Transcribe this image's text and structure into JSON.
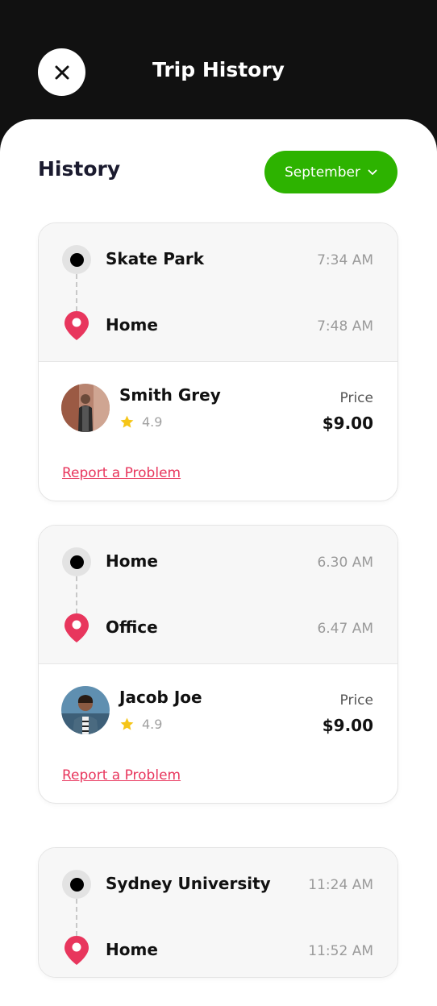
{
  "header": {
    "title": "Trip History",
    "close_icon": "close-icon"
  },
  "section": {
    "title": "History",
    "month_filter": "September"
  },
  "colors": {
    "accent_green": "#2db300",
    "pin_red": "#e8365d",
    "star_yellow": "#f5c518",
    "header_bg": "#111111"
  },
  "trips": [
    {
      "from": "Skate Park",
      "from_time": "7:34 AM",
      "to": "Home",
      "to_time": "7:48 AM",
      "driver": "Smith Grey",
      "rating": "4.9",
      "price_label": "Price",
      "price": "$9.00",
      "report_label": "Report a Problem"
    },
    {
      "from": "Home",
      "from_time": "6.30 AM",
      "to": "Office",
      "to_time": "6.47 AM",
      "driver": "Jacob Joe",
      "rating": "4.9",
      "price_label": "Price",
      "price": "$9.00",
      "report_label": "Report a Problem"
    },
    {
      "from": "Sydney University",
      "from_time": "11:24 AM",
      "to": "Home",
      "to_time": "11:52 AM"
    }
  ]
}
